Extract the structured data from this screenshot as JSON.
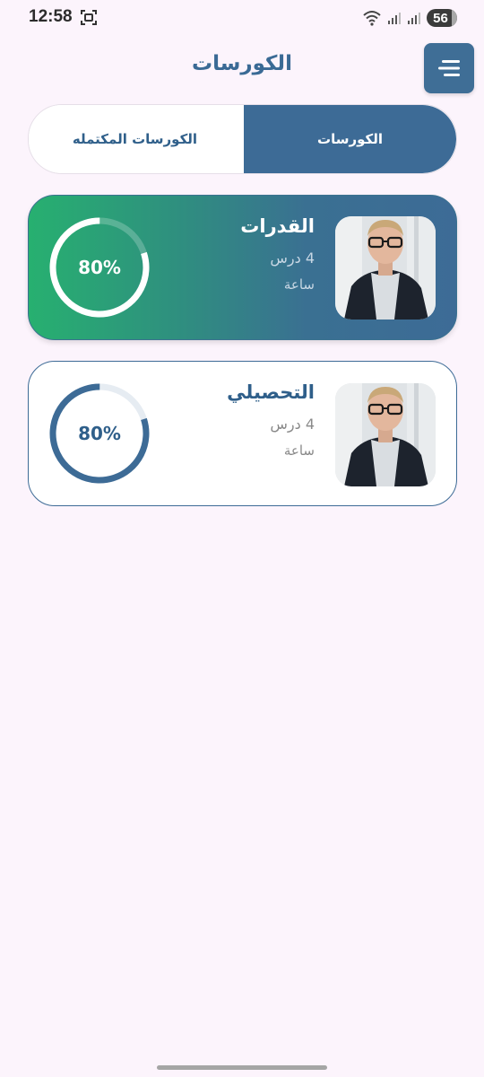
{
  "status_bar": {
    "time": "12:58",
    "battery": "56",
    "icons": [
      "screen-record-icon",
      "wifi-icon",
      "signal-icon",
      "signal-icon"
    ]
  },
  "header": {
    "title": "الكورسات",
    "menu_icon": "menu-icon"
  },
  "tabs": [
    {
      "label": "الكورسات",
      "active": true
    },
    {
      "label": "الكورسات المكتمله",
      "active": false
    }
  ],
  "courses": [
    {
      "name": "القدرات",
      "lessons": "4 درس",
      "hours": "ساعة",
      "progress_label": "80%",
      "progress": 0.8,
      "highlighted": true
    },
    {
      "name": "التحصيلي",
      "lessons": "4 درس",
      "hours": "ساعة",
      "progress_label": "80%",
      "progress": 0.8,
      "highlighted": false
    }
  ],
  "colors": {
    "primary": "#3d6b96",
    "accent_green": "#27b070",
    "background": "#fcf4fc"
  }
}
